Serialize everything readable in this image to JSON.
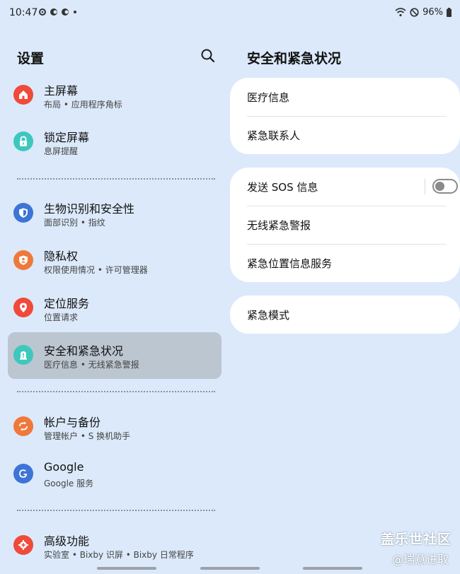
{
  "status_bar": {
    "time": "10:47",
    "battery": "96%"
  },
  "settings": {
    "title": "设置",
    "items": [
      {
        "title": "主屏幕",
        "subtitle": "布局 • 应用程序角标",
        "icon": "home-icon",
        "color": "#ef4a3a"
      },
      {
        "title": "锁定屏幕",
        "subtitle": "息屏提醒",
        "icon": "lock-icon",
        "color": "#3ec7bd"
      },
      {
        "title": "生物识别和安全性",
        "subtitle": "面部识别 • 指纹",
        "icon": "shield-icon",
        "color": "#3d74d6"
      },
      {
        "title": "隐私权",
        "subtitle": "权限使用情况 • 许可管理器",
        "icon": "privacy-icon",
        "color": "#f0783a"
      },
      {
        "title": "定位服务",
        "subtitle": "位置请求",
        "icon": "location-pin-icon",
        "color": "#ef4a3a"
      },
      {
        "title": "安全和紧急状况",
        "subtitle": "医疗信息 • 无线紧急警报",
        "icon": "emergency-icon",
        "color": "#3ec7bd"
      },
      {
        "title": "帐户与备份",
        "subtitle": "管理帐户 • S 换机助手",
        "icon": "sync-icon",
        "color": "#f0783a"
      },
      {
        "title": "Google",
        "subtitle": "Google 服务",
        "icon": "google-icon",
        "color": "#3d74d6"
      },
      {
        "title": "高级功能",
        "subtitle": "实验室 • Bixby 识屏 • Bixby 日常程序",
        "icon": "gear-plus-icon",
        "color": "#ef4a3a"
      }
    ]
  },
  "detail": {
    "title": "安全和紧急状况",
    "card1": [
      "医疗信息",
      "紧急联系人"
    ],
    "card2": [
      "发送 SOS 信息",
      "无线紧急警报",
      "紧急位置信息服务"
    ],
    "card3": [
      "紧急模式"
    ],
    "sos_toggle_on": false
  },
  "watermark": {
    "line1": "盖乐世社区",
    "line2": "@瑞意进取"
  }
}
